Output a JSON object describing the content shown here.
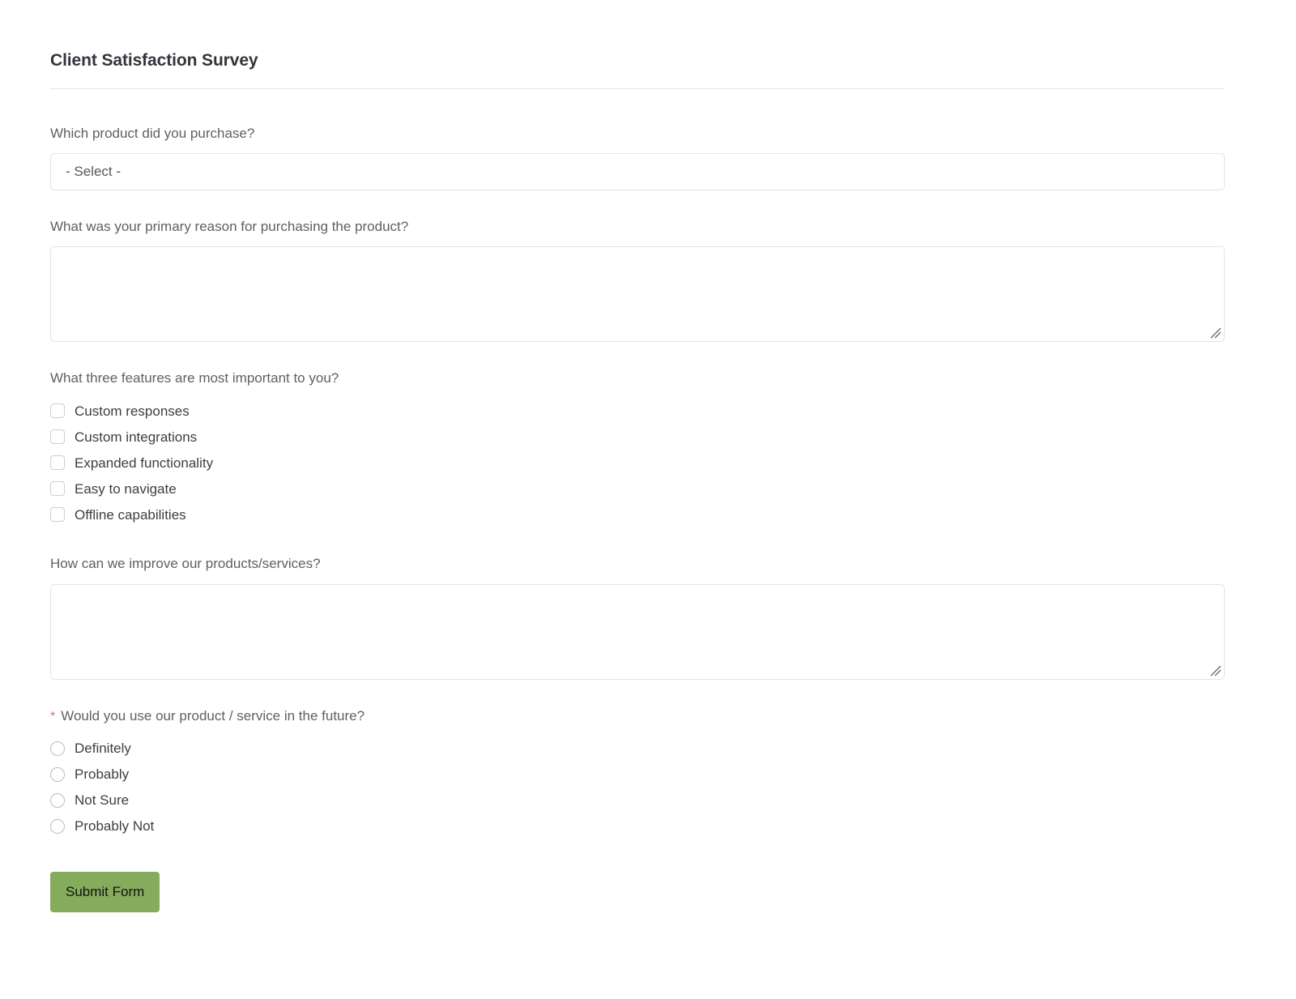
{
  "form": {
    "title": "Client Satisfaction Survey",
    "required_marker": "*",
    "accent_green": "#85ac5d",
    "required_color": "#e8705f",
    "border_color": "#e3e4e6",
    "label_color": "#5d6066",
    "submit_label": "Submit Form"
  },
  "questions": {
    "product": {
      "label": "Which product did you purchase?",
      "selected_value": "- Select -",
      "placeholder": "- Select -"
    },
    "reason": {
      "label": "What was your primary reason for purchasing the product?",
      "value": "",
      "placeholder": ""
    },
    "features": {
      "label": "What three features are most important to you?",
      "options": [
        {
          "label": "Custom responses",
          "checked": false
        },
        {
          "label": "Custom integrations",
          "checked": false
        },
        {
          "label": "Expanded functionality",
          "checked": false
        },
        {
          "label": "Easy to navigate",
          "checked": false
        },
        {
          "label": "Offline capabilities",
          "checked": false
        }
      ]
    },
    "improve": {
      "label": "How can we improve our products/services?",
      "value": "",
      "placeholder": ""
    },
    "future_use": {
      "label": "Would you use our product / service in the future?",
      "required": true,
      "options": [
        {
          "label": "Definitely",
          "selected": false
        },
        {
          "label": "Probably",
          "selected": false
        },
        {
          "label": "Not Sure",
          "selected": false
        },
        {
          "label": "Probably Not",
          "selected": false
        }
      ]
    }
  }
}
